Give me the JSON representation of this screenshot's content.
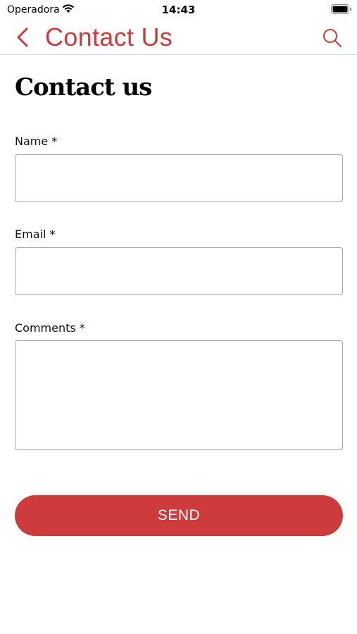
{
  "status_bar": {
    "carrier": "Operadora",
    "time": "14:43",
    "wifi_icon": "wifi-icon",
    "battery_icon": "battery-icon"
  },
  "nav": {
    "back_icon": "chevron-left-icon",
    "title": "Contact Us",
    "search_icon": "search-icon"
  },
  "form": {
    "heading": "Contact us",
    "fields": [
      {
        "label": "Name *",
        "value": "",
        "placeholder": ""
      },
      {
        "label": "Email *",
        "value": "",
        "placeholder": ""
      },
      {
        "label": "Comments *",
        "value": "",
        "placeholder": ""
      }
    ],
    "send_label": "SEND"
  },
  "colors": {
    "accent": "#cd3b3c",
    "border": "#a9a9a9",
    "background": "#ffffff"
  }
}
